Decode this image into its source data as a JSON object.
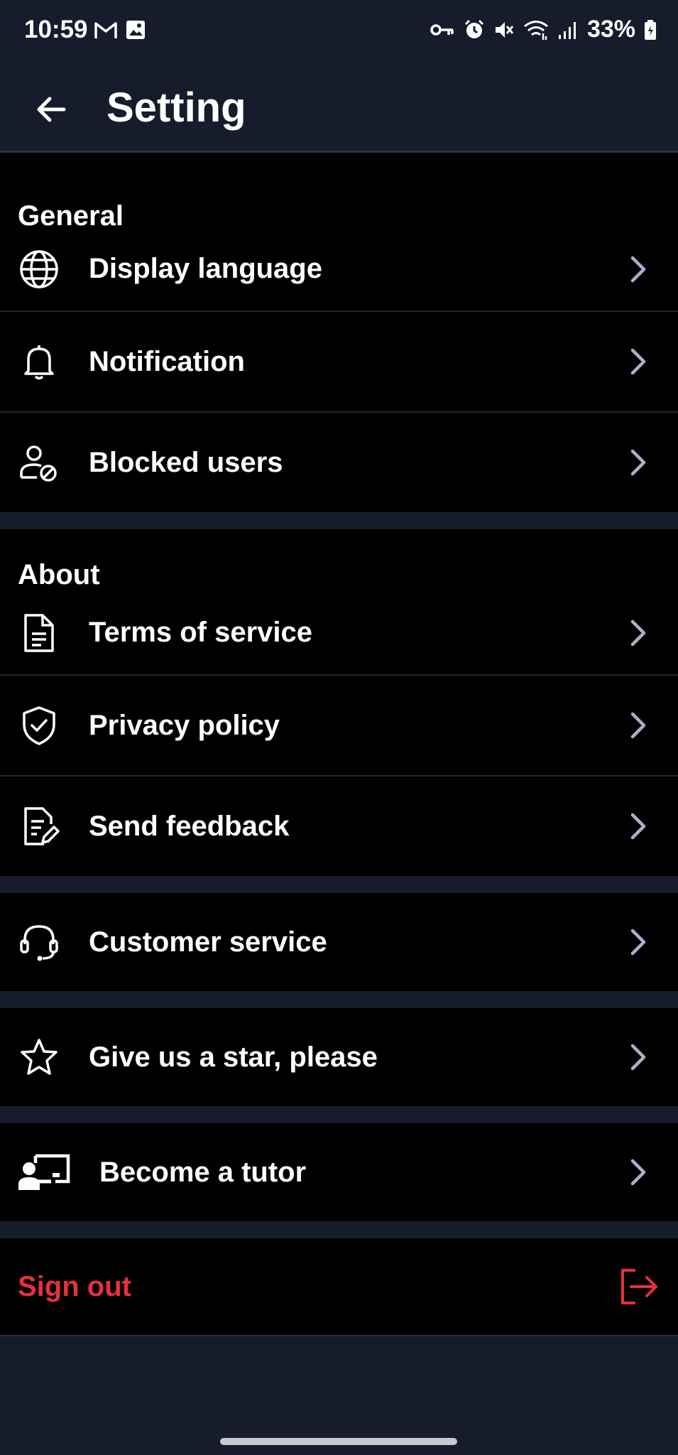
{
  "status": {
    "time": "10:59",
    "battery": "33%"
  },
  "appbar": {
    "title": "Setting"
  },
  "sections": {
    "general": {
      "heading": "General",
      "items": [
        "Display language",
        "Notification",
        "Blocked users"
      ]
    },
    "about": {
      "heading": "About",
      "items": [
        "Terms of service",
        "Privacy policy",
        "Send feedback"
      ]
    },
    "customer_service": "Customer service",
    "give_star": "Give us a star, please",
    "become_tutor": "Become a tutor",
    "sign_out": "Sign out"
  },
  "colors": {
    "background": "#000000",
    "header": "#161c2c",
    "accent_red": "#e5313d",
    "chevron": "#aab0c8"
  },
  "icons": [
    "globe-icon",
    "bell-icon",
    "blocked-user-icon",
    "document-icon",
    "shield-check-icon",
    "feedback-edit-icon",
    "headset-icon",
    "star-icon",
    "tutor-board-icon",
    "logout-icon"
  ]
}
